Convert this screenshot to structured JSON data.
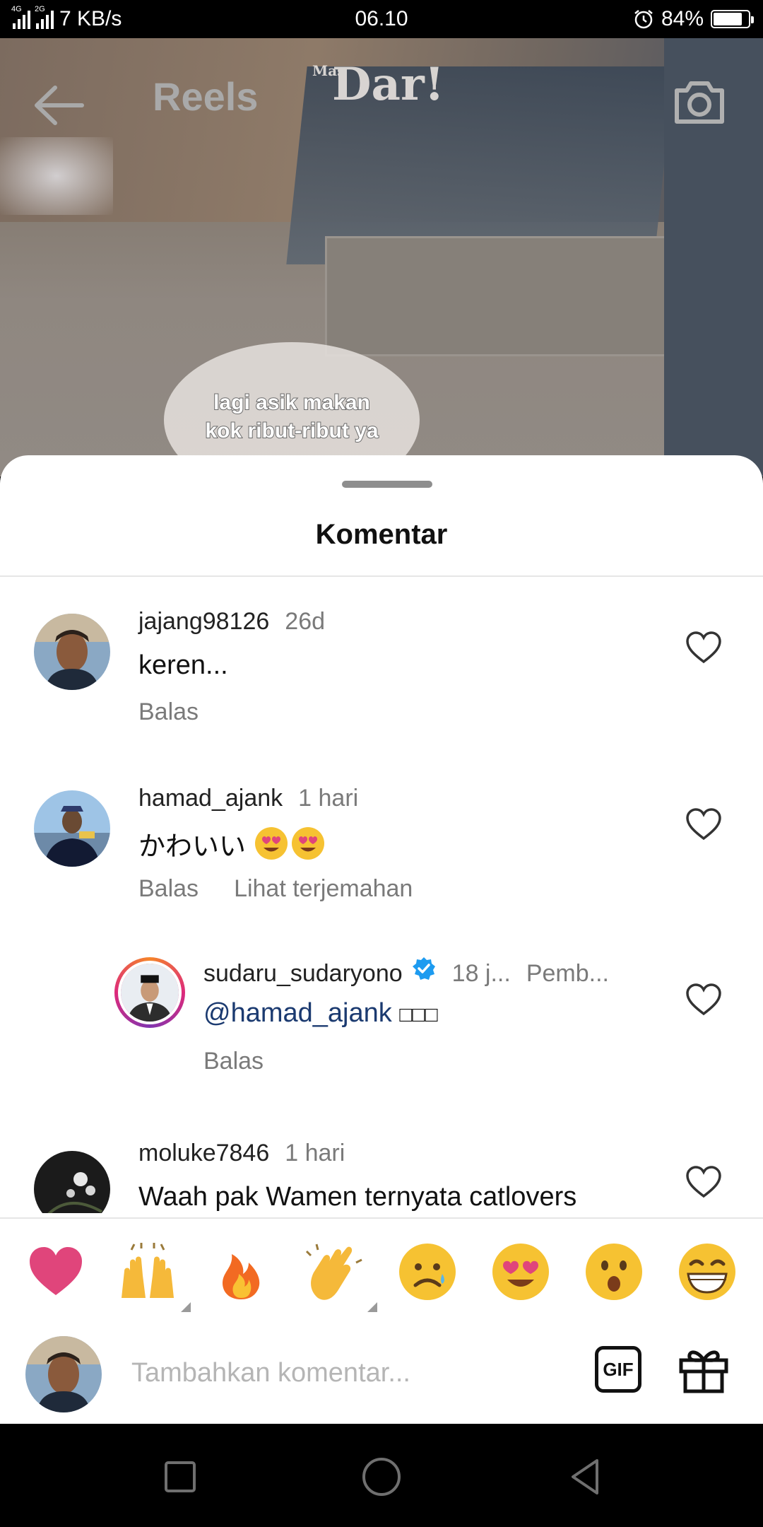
{
  "status_bar": {
    "network_1": "4G",
    "network_2": "2G",
    "speed": "7 KB/s",
    "time": "06.10",
    "battery_percent": "84%",
    "battery_level": 0.84
  },
  "reel": {
    "title": "Reels",
    "watermark_main": "Dar!",
    "watermark_small": "Mas",
    "caption_line1": "lagi asik makan",
    "caption_line2": "kok ribut-ribut ya"
  },
  "sheet": {
    "title": "Komentar"
  },
  "comments": [
    {
      "username": "jajang98126",
      "time": "26d",
      "text": "keren...",
      "reply_label": "Balas"
    },
    {
      "username": "hamad_ajank",
      "time": "1 hari",
      "text": "かわいい",
      "emojis": [
        "smiling-face-with-heart-eyes",
        "smiling-face-with-heart-eyes"
      ],
      "reply_label": "Balas",
      "translate_label": "Lihat terjemahan"
    },
    {
      "username": "sudaru_sudaryono",
      "verified": true,
      "time": "18 j...",
      "pinned_label": "Pemb...",
      "mention": "@hamad_ajank",
      "suffix": "□□□",
      "reply_label": "Balas"
    },
    {
      "username": "moluke7846",
      "time": "1 hari",
      "text": "Waah pak Wamen ternyata catlovers"
    }
  ],
  "reactions": [
    "red-heart",
    "raising-hands",
    "fire",
    "clapping-hands",
    "sad-face",
    "heart-eyes-face",
    "surprised-face",
    "grinning-face"
  ],
  "input": {
    "placeholder": "Tambahkan komentar...",
    "gif_label": "GIF"
  },
  "colors": {
    "accent_link": "#1b3a70",
    "verified_blue": "#1d9bf0",
    "heart_pink": "#e0457b"
  }
}
